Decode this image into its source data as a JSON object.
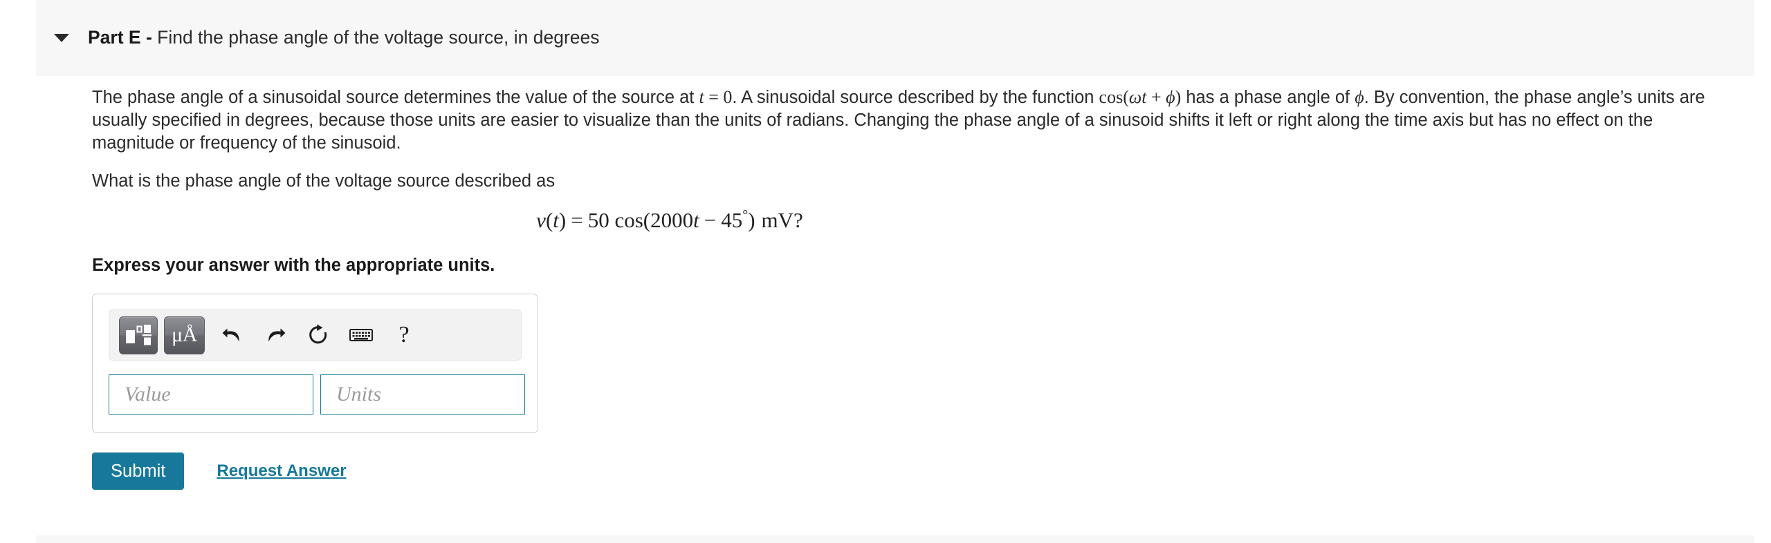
{
  "part_header": {
    "caret_icon": "chevron-down-icon",
    "label": "Part E -",
    "description": " Find the phase angle of the voltage source, in degrees"
  },
  "body": {
    "paragraph": {
      "seg1": "The phase angle of a sinusoidal source determines the value of the source at ",
      "math_t": "t",
      "math_eq0": " = 0",
      "seg2": ". A sinusoidal source described by the function ",
      "math_cos": "cos(",
      "math_omega_t": "ωt",
      "math_plus": " + ",
      "math_phi": "ϕ",
      "math_close": ")",
      "seg3": " has a phase angle of ",
      "math_phi2": "ϕ",
      "seg4": ". By convention, the phase angle’s units are usually specified in degrees, because those units are easier to visualize than the units of radians. Changing the phase angle of a sinusoid shifts it left or right along the time axis but has no effect on the magnitude or frequency of the sinusoid."
    },
    "question": "What is the phase angle of the voltage source described as",
    "equation": {
      "lhs_v": "v",
      "lhs_open": "(",
      "lhs_t": "t",
      "lhs_close": ")",
      "equals": "=",
      "amplitude": "50",
      "cos": "cos(",
      "freq": "2000",
      "var_t": "t",
      "minus": "−",
      "phase": "45",
      "degree": "°",
      "close_paren": ")",
      "units": "mV",
      "qmark": "?",
      "plain_text": "v(t) = 50 cos(2000t − 45°) mV?"
    },
    "instruction": "Express your answer with the appropriate units."
  },
  "answer_widget": {
    "toolbar": {
      "templates_button": "math-templates-icon",
      "units_button": "μÅ",
      "undo": "undo-arrow-icon",
      "redo": "redo-arrow-icon",
      "reset": "reset-circular-arrow-icon",
      "keyboard": "keyboard-icon",
      "help": "?"
    },
    "value_field": {
      "placeholder": "Value",
      "value": ""
    },
    "units_field": {
      "placeholder": "Units",
      "value": ""
    }
  },
  "actions": {
    "submit_label": "Submit",
    "request_answer_label": "Request Answer"
  },
  "colors": {
    "accent_teal": "#17789b",
    "band_gray": "#f7f7f7",
    "text": "#2b2b2b"
  }
}
